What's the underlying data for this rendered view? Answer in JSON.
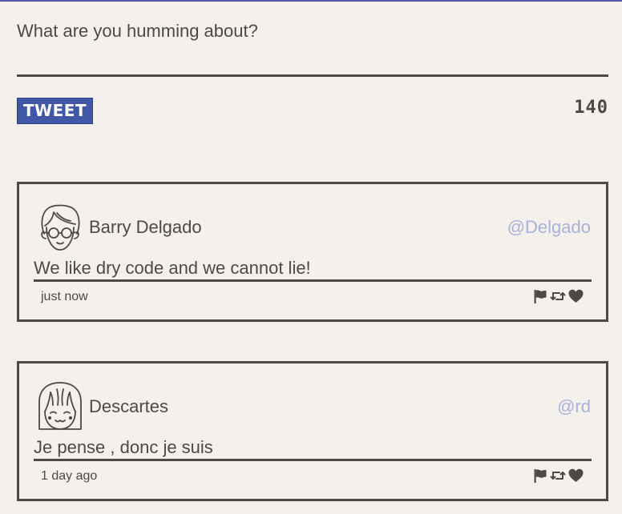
{
  "compose": {
    "placeholder": "What are you humming about?",
    "tweet_label": "TWEET",
    "char_count": "140"
  },
  "tweets": [
    {
      "name": "Barry Delgado",
      "handle": "@Delgado",
      "text": "We like dry code and we cannot lie!",
      "time": "just now",
      "avatar_icon": "boy-glasses-avatar-icon"
    },
    {
      "name": "Descartes",
      "handle": "@rd",
      "text": "Je pense , donc je suis",
      "time": "1 day ago",
      "avatar_icon": "girl-bangs-avatar-icon"
    }
  ],
  "colors": {
    "background": "#f4f1ec",
    "text": "#4d4a46",
    "accent": "#4158a6",
    "handle": "#a9b0da"
  }
}
